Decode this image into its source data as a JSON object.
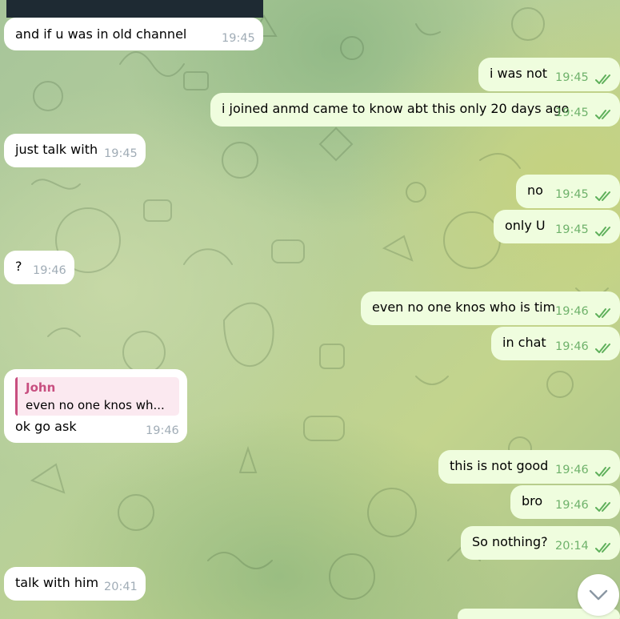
{
  "app": "Telegram",
  "colors": {
    "incoming_bubble": "#ffffff",
    "outgoing_bubble": "#effdde",
    "outgoing_time": "#6fb26b",
    "incoming_time": "#a0acb6",
    "read_checks": "#5fb05b",
    "reply_accent": "#c84f80"
  },
  "messages": [
    {
      "direction": "in",
      "text": "and if u was in old channel",
      "time": "19:45"
    },
    {
      "direction": "out",
      "text": "i was not",
      "time": "19:45",
      "status": "read"
    },
    {
      "direction": "out",
      "text": "i joined anmd came to know abt this only 20 days ago",
      "time": "19:45",
      "status": "read"
    },
    {
      "direction": "in",
      "text": "just talk with",
      "time": "19:45"
    },
    {
      "direction": "out",
      "text": "no",
      "time": "19:45",
      "status": "read"
    },
    {
      "direction": "out",
      "text": "only U",
      "time": "19:45",
      "status": "read"
    },
    {
      "direction": "in",
      "text": "?",
      "time": "19:46"
    },
    {
      "direction": "out",
      "text": "even no one knos who is tim",
      "time": "19:46",
      "status": "read"
    },
    {
      "direction": "out",
      "text": "in chat",
      "time": "19:46",
      "status": "read"
    },
    {
      "direction": "in",
      "text": "ok go ask",
      "time": "19:46",
      "reply_to": {
        "author": "John",
        "text": "even no one knos wh..."
      }
    },
    {
      "direction": "out",
      "text": "this is not good",
      "time": "19:46",
      "status": "read"
    },
    {
      "direction": "out",
      "text": "bro",
      "time": "19:46",
      "status": "read"
    },
    {
      "direction": "out",
      "text": "So nothing?",
      "time": "20:14",
      "status": "read"
    },
    {
      "direction": "in",
      "text": "talk with him",
      "time": "20:41"
    }
  ],
  "icons": {
    "read_receipt": "double-check-icon",
    "scroll_button": "chevron-down-icon"
  }
}
